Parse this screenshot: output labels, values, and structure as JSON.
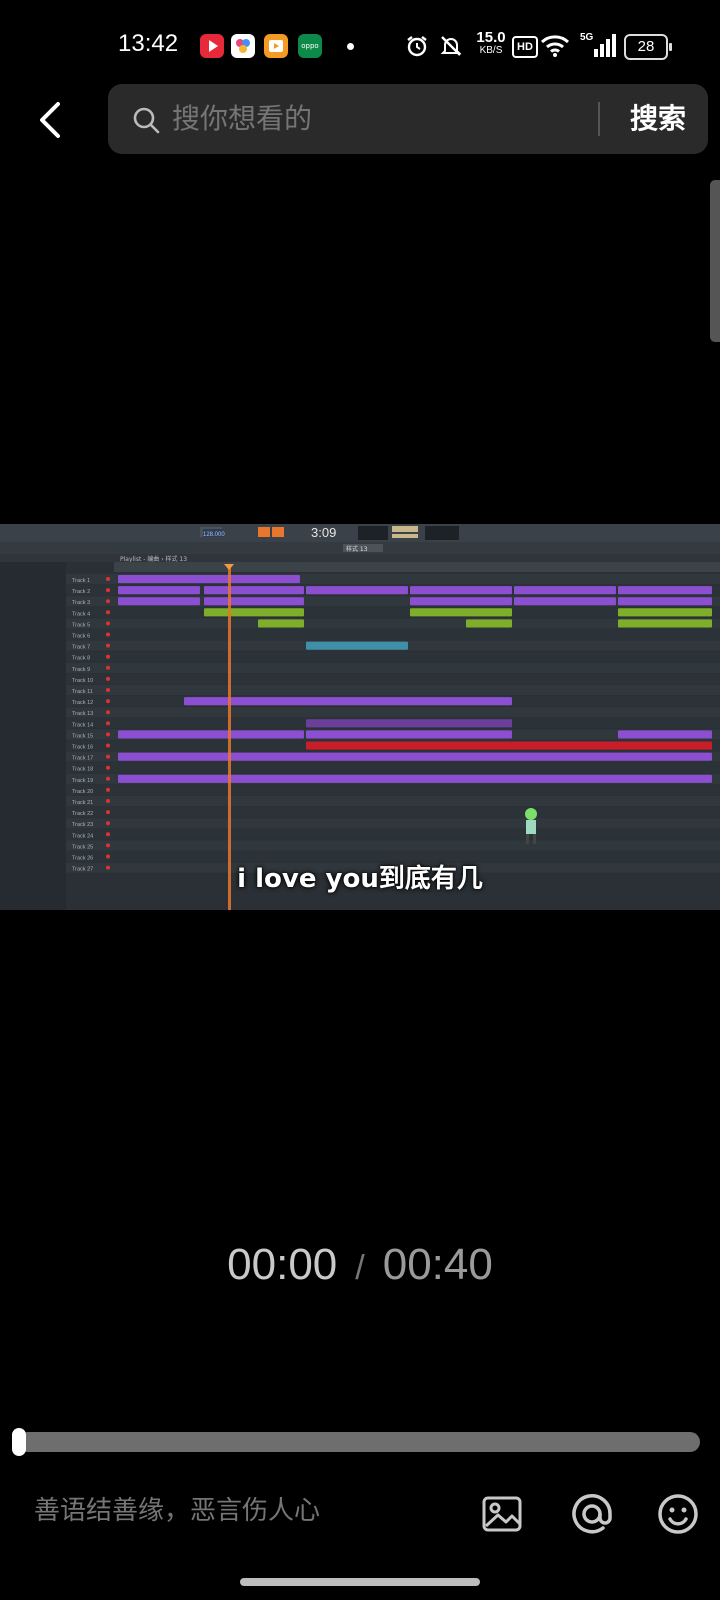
{
  "status_bar": {
    "time": "13:42",
    "app_icons": [
      {
        "name": "red-video-app-icon",
        "color": "#e8293a"
      },
      {
        "name": "colorful-app-icon",
        "color": "#ffffff"
      },
      {
        "name": "orange-video-app-icon",
        "color": "#f59a23"
      },
      {
        "name": "oppo-app-icon",
        "color": "#0d8a4a",
        "label": "oppo"
      }
    ],
    "net_speed_value": "15.0",
    "net_speed_unit": "KB/S",
    "hd_label": "HD",
    "signal_label": "5G",
    "battery": "28"
  },
  "search": {
    "placeholder": "搜你想看的",
    "button_label": "搜索"
  },
  "video": {
    "subtitle": "i love you到底有几",
    "daw": {
      "clock": "3:09",
      "bpm": "128.000",
      "pattern": "样式 13",
      "player_title": "Playlist - 编曲 › 样式 13",
      "tracks": [
        "Track 1",
        "Track 2",
        "Track 3",
        "Track 4",
        "Track 5",
        "Track 6",
        "Track 7",
        "Track 8",
        "Track 9",
        "Track 10",
        "Track 11",
        "Track 12",
        "Track 13",
        "Track 14",
        "Track 15",
        "Track 16",
        "Track 17",
        "Track 18",
        "Track 19",
        "Track 20",
        "Track 21",
        "Track 22",
        "Track 23",
        "Track 24",
        "Track 25",
        "Track 26",
        "Track 27"
      ]
    }
  },
  "playback": {
    "current": "00:00",
    "separator": "/",
    "total": "00:40",
    "progress": 0.0
  },
  "comment": {
    "placeholder": "善语结善缘，恶言伤人心"
  },
  "colors": {
    "background": "#000000",
    "search_bg": "#2a2a2a",
    "progress_track": "#6e6e6e"
  }
}
